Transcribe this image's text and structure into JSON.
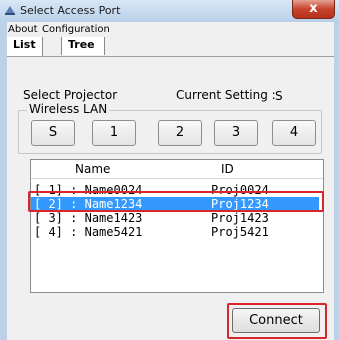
{
  "window": {
    "title": "Select Access Port",
    "close_label": "x"
  },
  "menu": {
    "items": [
      {
        "label": "About"
      },
      {
        "label": "Configuration"
      }
    ]
  },
  "tabs": [
    {
      "label": "List",
      "selected": true
    },
    {
      "label": "Tree",
      "selected": false
    }
  ],
  "panel": {
    "select_projector_label": "Select Projector",
    "current_setting_label": "Current Setting :",
    "current_setting_value": "S",
    "group_label": "Wireless LAN",
    "port_buttons": [
      "S",
      "1",
      "2",
      "3",
      "4"
    ]
  },
  "list": {
    "headers": {
      "name": "Name",
      "id": "ID"
    },
    "rows": [
      {
        "index": "[ 1] :",
        "name": "Name0024",
        "id": "Proj0024",
        "selected": false
      },
      {
        "index": "[ 2] :",
        "name": "Name1234",
        "id": "Proj1234",
        "selected": true
      },
      {
        "index": "[ 3] :",
        "name": "Name1423",
        "id": "Proj1423",
        "selected": false
      },
      {
        "index": "[ 4] :",
        "name": "Name5421",
        "id": "Proj5421",
        "selected": false
      }
    ]
  },
  "actions": {
    "connect_label": "Connect"
  },
  "colors": {
    "selection": "#3399ff",
    "highlight_outline": "#d9262b",
    "title_gradient_top": "#d9e7f6",
    "close_button": "#c6432b"
  }
}
